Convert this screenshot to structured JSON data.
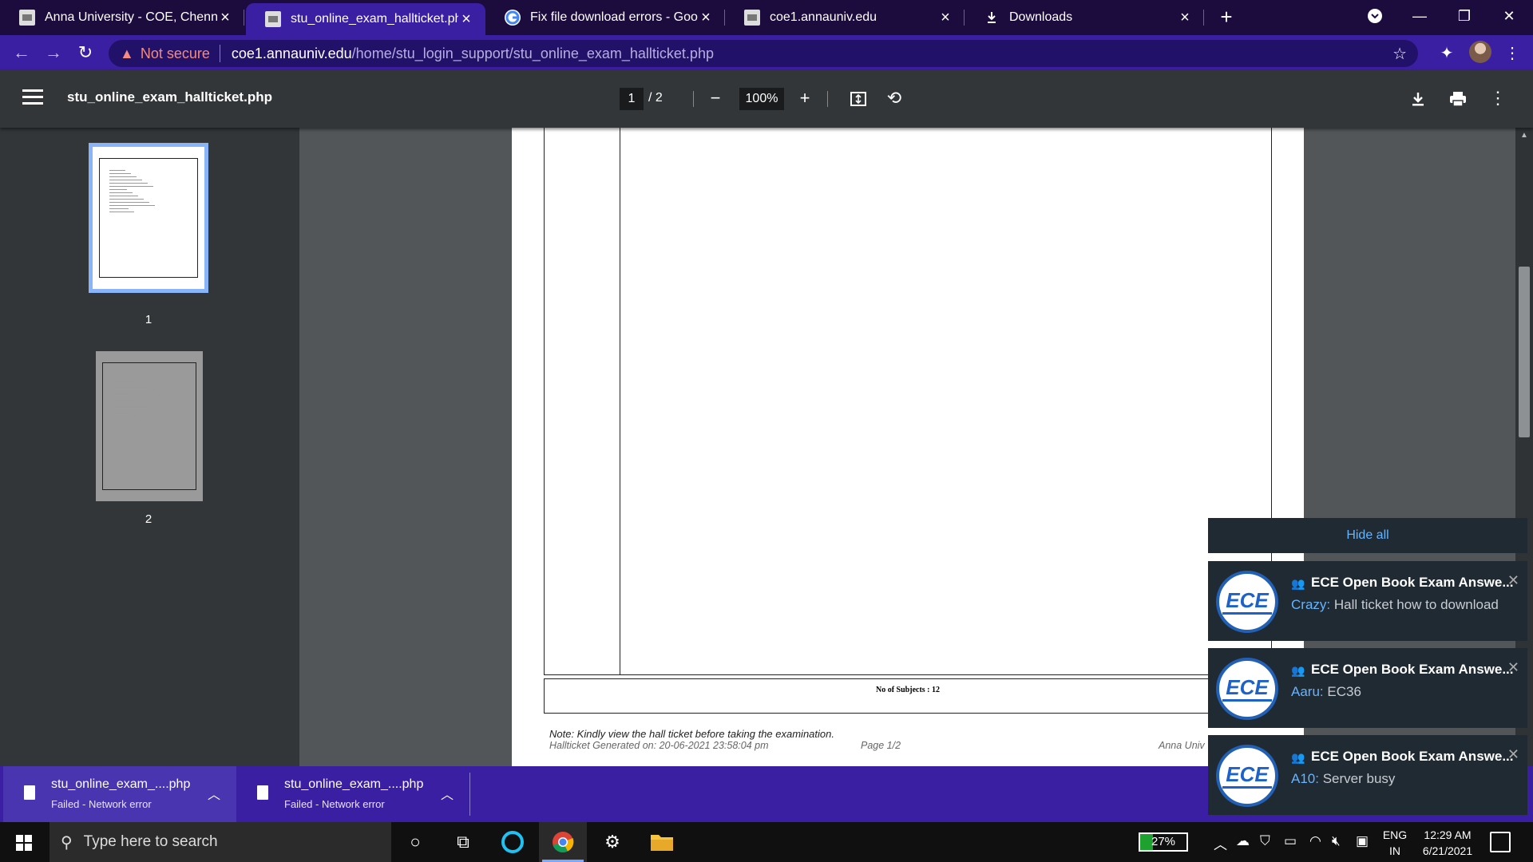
{
  "browser": {
    "tabs": [
      {
        "title": "Anna University - COE, Chennai",
        "icon": "page-favicon-icon"
      },
      {
        "title": "stu_online_exam_hallticket.php",
        "icon": "page-favicon-icon",
        "active": true
      },
      {
        "title": "Fix file download errors - Google",
        "icon": "google-icon"
      },
      {
        "title": "coe1.annauniv.edu",
        "icon": "page-favicon-icon"
      },
      {
        "title": "Downloads",
        "icon": "download-icon"
      }
    ],
    "security_label": "Not secure",
    "url_host": "coe1.annauniv.edu",
    "url_path": "/home/stu_login_support/stu_online_exam_hallticket.php"
  },
  "pdf_viewer": {
    "title": "stu_online_exam_hallticket.php",
    "current_page": "1",
    "total_pages": "/  2",
    "zoom": "100%",
    "thumbnails": [
      "1",
      "2"
    ]
  },
  "document": {
    "subjects_count": "No of Subjects : 12",
    "note": "Note: Kindly view the hall ticket before taking the examination.",
    "generated": "Hallticket Generated on: 20-06-2021 23:58:04 pm",
    "page_label": "Page 1/2",
    "footer_right": "Anna Univ"
  },
  "downloads": [
    {
      "name": "stu_online_exam_....php",
      "status": "Failed - Network error"
    },
    {
      "name": "stu_online_exam_....php",
      "status": "Failed - Network error"
    }
  ],
  "notifications": {
    "hide_all": "Hide all",
    "items": [
      {
        "title": "ECE Open Book Exam Answe...",
        "sender": "Crazy:",
        "message": "Hall ticket how to download",
        "logo_text": "ECE"
      },
      {
        "title": "ECE Open Book Exam Answe...",
        "sender": "Aaru:",
        "message": "EC36",
        "logo_text": "ECE"
      },
      {
        "title": "ECE Open Book Exam Answe...",
        "sender": "A10:",
        "message": "Server busy",
        "logo_text": "ECE"
      }
    ]
  },
  "taskbar": {
    "search_placeholder": "Type here to search",
    "battery": "27%",
    "battery_level": 0.27,
    "lang_line1": "ENG",
    "lang_line2": "IN",
    "time": "12:29 AM",
    "date": "6/21/2021"
  },
  "colors": {
    "tabstrip": "#1c0b3d",
    "toolbar": "#3b1fa3",
    "pdf_toolbar": "#323639",
    "pdf_background": "#525659",
    "insecure_warning": "#f28b82",
    "notification_link": "#66b4ff"
  }
}
